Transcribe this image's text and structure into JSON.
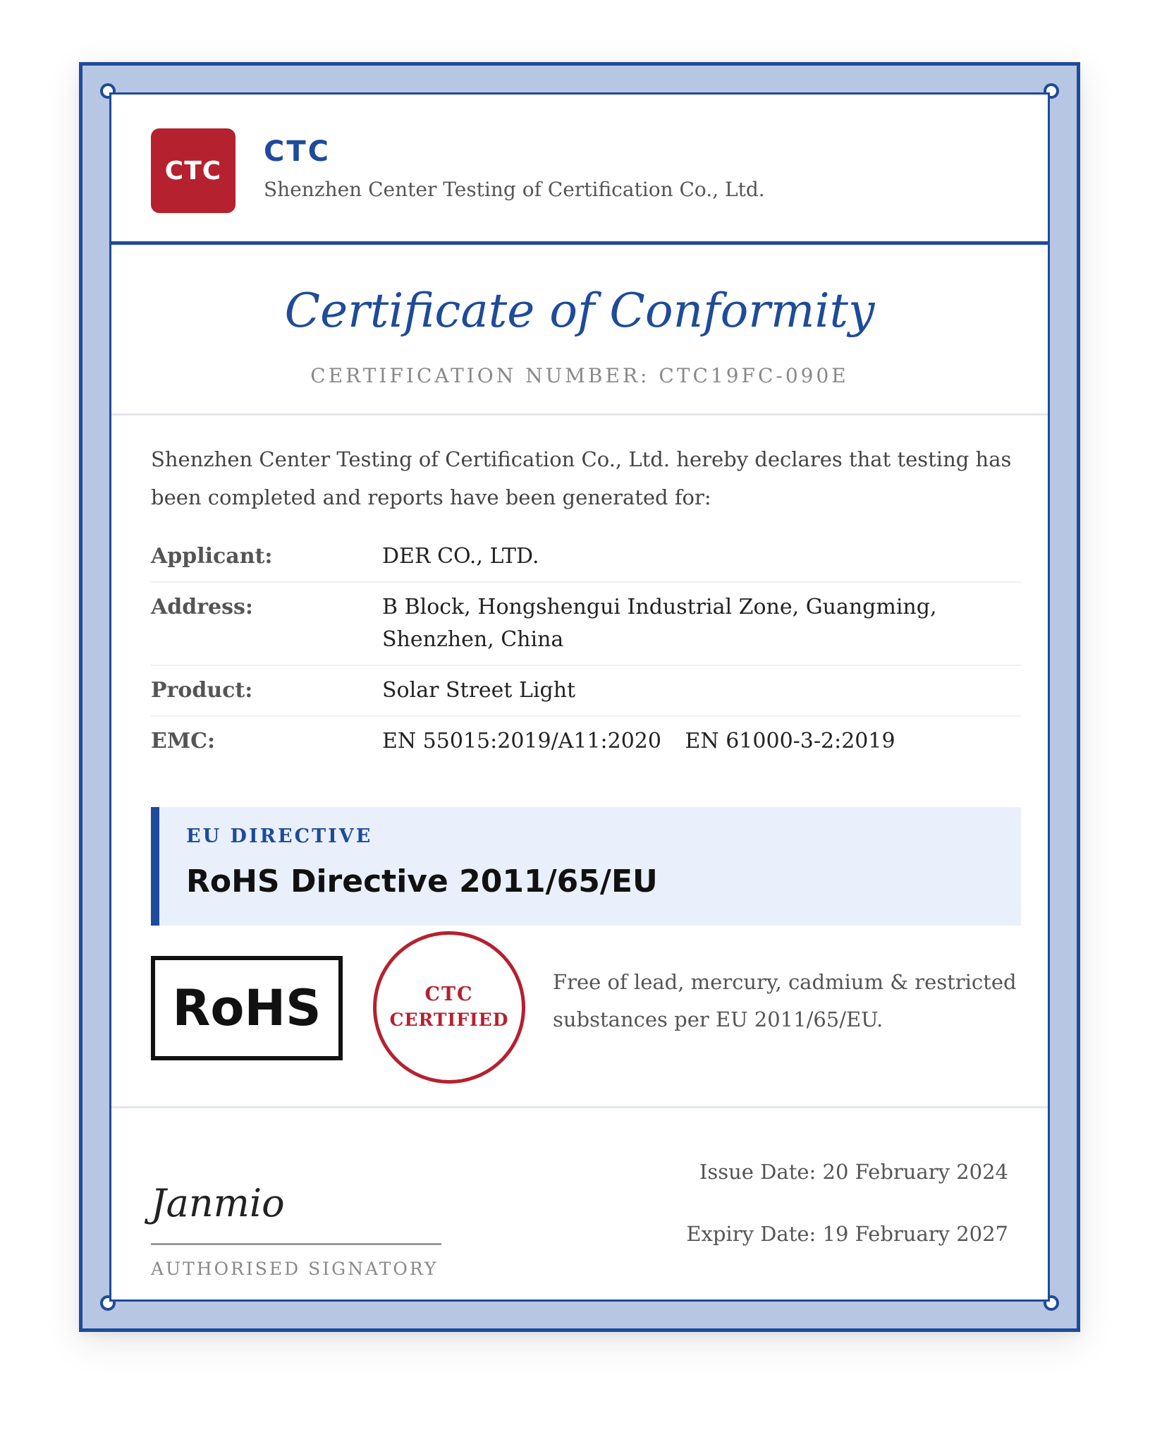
{
  "header": {
    "logo_text": "CTC",
    "abbreviation": "CTC",
    "company_name": "Shenzhen Center Testing of Certification Co., Ltd."
  },
  "title": {
    "heading": "Certificate of Conformity",
    "cert_number": "CERTIFICATION NUMBER: CTC19FC-090E"
  },
  "declaration": "Shenzhen Center Testing of Certification Co., Ltd. hereby declares that testing has been completed and reports have been generated for:",
  "details": {
    "applicant": {
      "label": "Applicant:",
      "value": "DER CO., LTD."
    },
    "address": {
      "label": "Address:",
      "value": "B Block, Hongshengui Industrial Zone, Guangming, Shenzhen, China"
    },
    "product": {
      "label": "Product:",
      "value": "Solar Street Light"
    },
    "emc": {
      "label": "EMC:",
      "standards": [
        "EN 55015:2019/A11:2020",
        "EN 61000-3-2:2019"
      ]
    }
  },
  "directive": {
    "label": "EU DIRECTIVE",
    "name": "RoHS Directive 2011/65/EU"
  },
  "badges": {
    "rohs_logo": "RoHS",
    "seal_top": "CTC",
    "seal_bottom": "CERTIFIED",
    "restriction_note": "Free of lead, mercury, cadmium & restricted substances per EU 2011/65/EU."
  },
  "signature": {
    "name": "Janmio",
    "role": "AUTHORISED SIGNATORY"
  },
  "dates": {
    "issue": "Issue Date: 20 February 2024",
    "expiry": "Expiry Date: 19 February 2027"
  },
  "colors": {
    "primary_blue": "#1e4b9a",
    "frame_blue": "#b7c6e2",
    "brand_red": "#b5212f",
    "directive_bg": "#eaf0fb"
  }
}
